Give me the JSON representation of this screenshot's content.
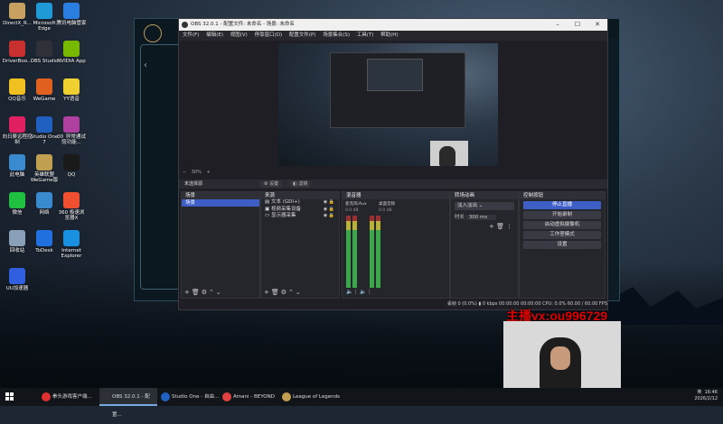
{
  "desktop_icons": [
    {
      "label": "DirectX_R...",
      "color": "#c8a060"
    },
    {
      "label": "Microsoft Edge",
      "color": "#1f9ad6"
    },
    {
      "label": "腾讯电脑管家",
      "color": "#2a7ee0"
    },
    {
      "label": "DriverBoo...",
      "color": "#c83030"
    },
    {
      "label": "OBS Studio",
      "color": "#303038"
    },
    {
      "label": "NVIDIA App",
      "color": "#76b900"
    },
    {
      "label": "QQ音乐",
      "color": "#f0c020"
    },
    {
      "label": "WeGame",
      "color": "#e06020"
    },
    {
      "label": "YY语音",
      "color": "#f0d030"
    },
    {
      "label": "向日葵远程控制",
      "color": "#e02060"
    },
    {
      "label": "Studio One 7",
      "color": "#2060c0"
    },
    {
      "label": "00_异常通试验功能...",
      "color": "#b040a0"
    },
    {
      "label": "此电脑",
      "color": "#3a8ad0"
    },
    {
      "label": "英雄联盟WeGame版",
      "color": "#c0a050"
    },
    {
      "label": "QQ",
      "color": "#1a1a1a"
    },
    {
      "label": "微信",
      "color": "#20c040"
    },
    {
      "label": "网络",
      "color": "#3a8ad0"
    },
    {
      "label": "360 极速浏览器X",
      "color": "#f05030"
    },
    {
      "label": "回收站",
      "color": "#8aa0b8"
    },
    {
      "label": "ToDesk",
      "color": "#2070e0"
    },
    {
      "label": "Internet Explorer",
      "color": "#1a90e0"
    },
    {
      "label": "UU加速器",
      "color": "#3060e0"
    }
  ],
  "obs": {
    "title": "OBS 32.0.1 - 配置文件: 未命名 - 场景: 未命名",
    "menu": [
      "文件(F)",
      "编辑(E)",
      "视图(V)",
      "停靠窗口(D)",
      "配置文件(P)",
      "场景集合(S)",
      "工具(T)",
      "帮助(H)"
    ],
    "zoom": "30%",
    "no_source": "未选择源",
    "properties_btn": "设置",
    "filters_btn": "滤镜",
    "scenes": {
      "header": "场景",
      "items": [
        "场景"
      ]
    },
    "sources": {
      "header": "来源",
      "items": [
        "文本 (GDI+)",
        "视频采集设备",
        "显示器采集"
      ]
    },
    "mixer": {
      "header": "混音器",
      "ch1": "麦克风/Aux",
      "ch2": "桌面音频",
      "db1": "0.0 dB",
      "db2": "0.0 dB"
    },
    "transitions": {
      "header": "转场动画",
      "type": "淡入淡出",
      "duration_label": "时长",
      "duration": "300 ms"
    },
    "controls": {
      "header": "控制按钮",
      "stop": "停止直播",
      "record": "开始录制",
      "vcam": "启动虚拟摄像机",
      "studio": "工作室模式",
      "settings": "设置"
    },
    "status": "丢帧 0 (0.0%)   ▮ 0 kbps   00:00:00   00:00:00   CPU: 0.0%  60.00 / 60.00 FPS"
  },
  "overlay_text": "主播vx:ou996729",
  "taskbar": {
    "items": [
      {
        "label": "拳头游戏客户端...",
        "color": "#e03030"
      },
      {
        "label": "OBS 32.0.1 - 配置...",
        "color": "#303038"
      },
      {
        "label": "Studio One - 自由...",
        "color": "#2060c0"
      },
      {
        "label": "Amani - BEYOND",
        "color": "#e04040"
      },
      {
        "label": "League of Legends",
        "color": "#c0a050"
      }
    ],
    "time": "16:46",
    "date": "2026/2/12",
    "lang": "英"
  }
}
